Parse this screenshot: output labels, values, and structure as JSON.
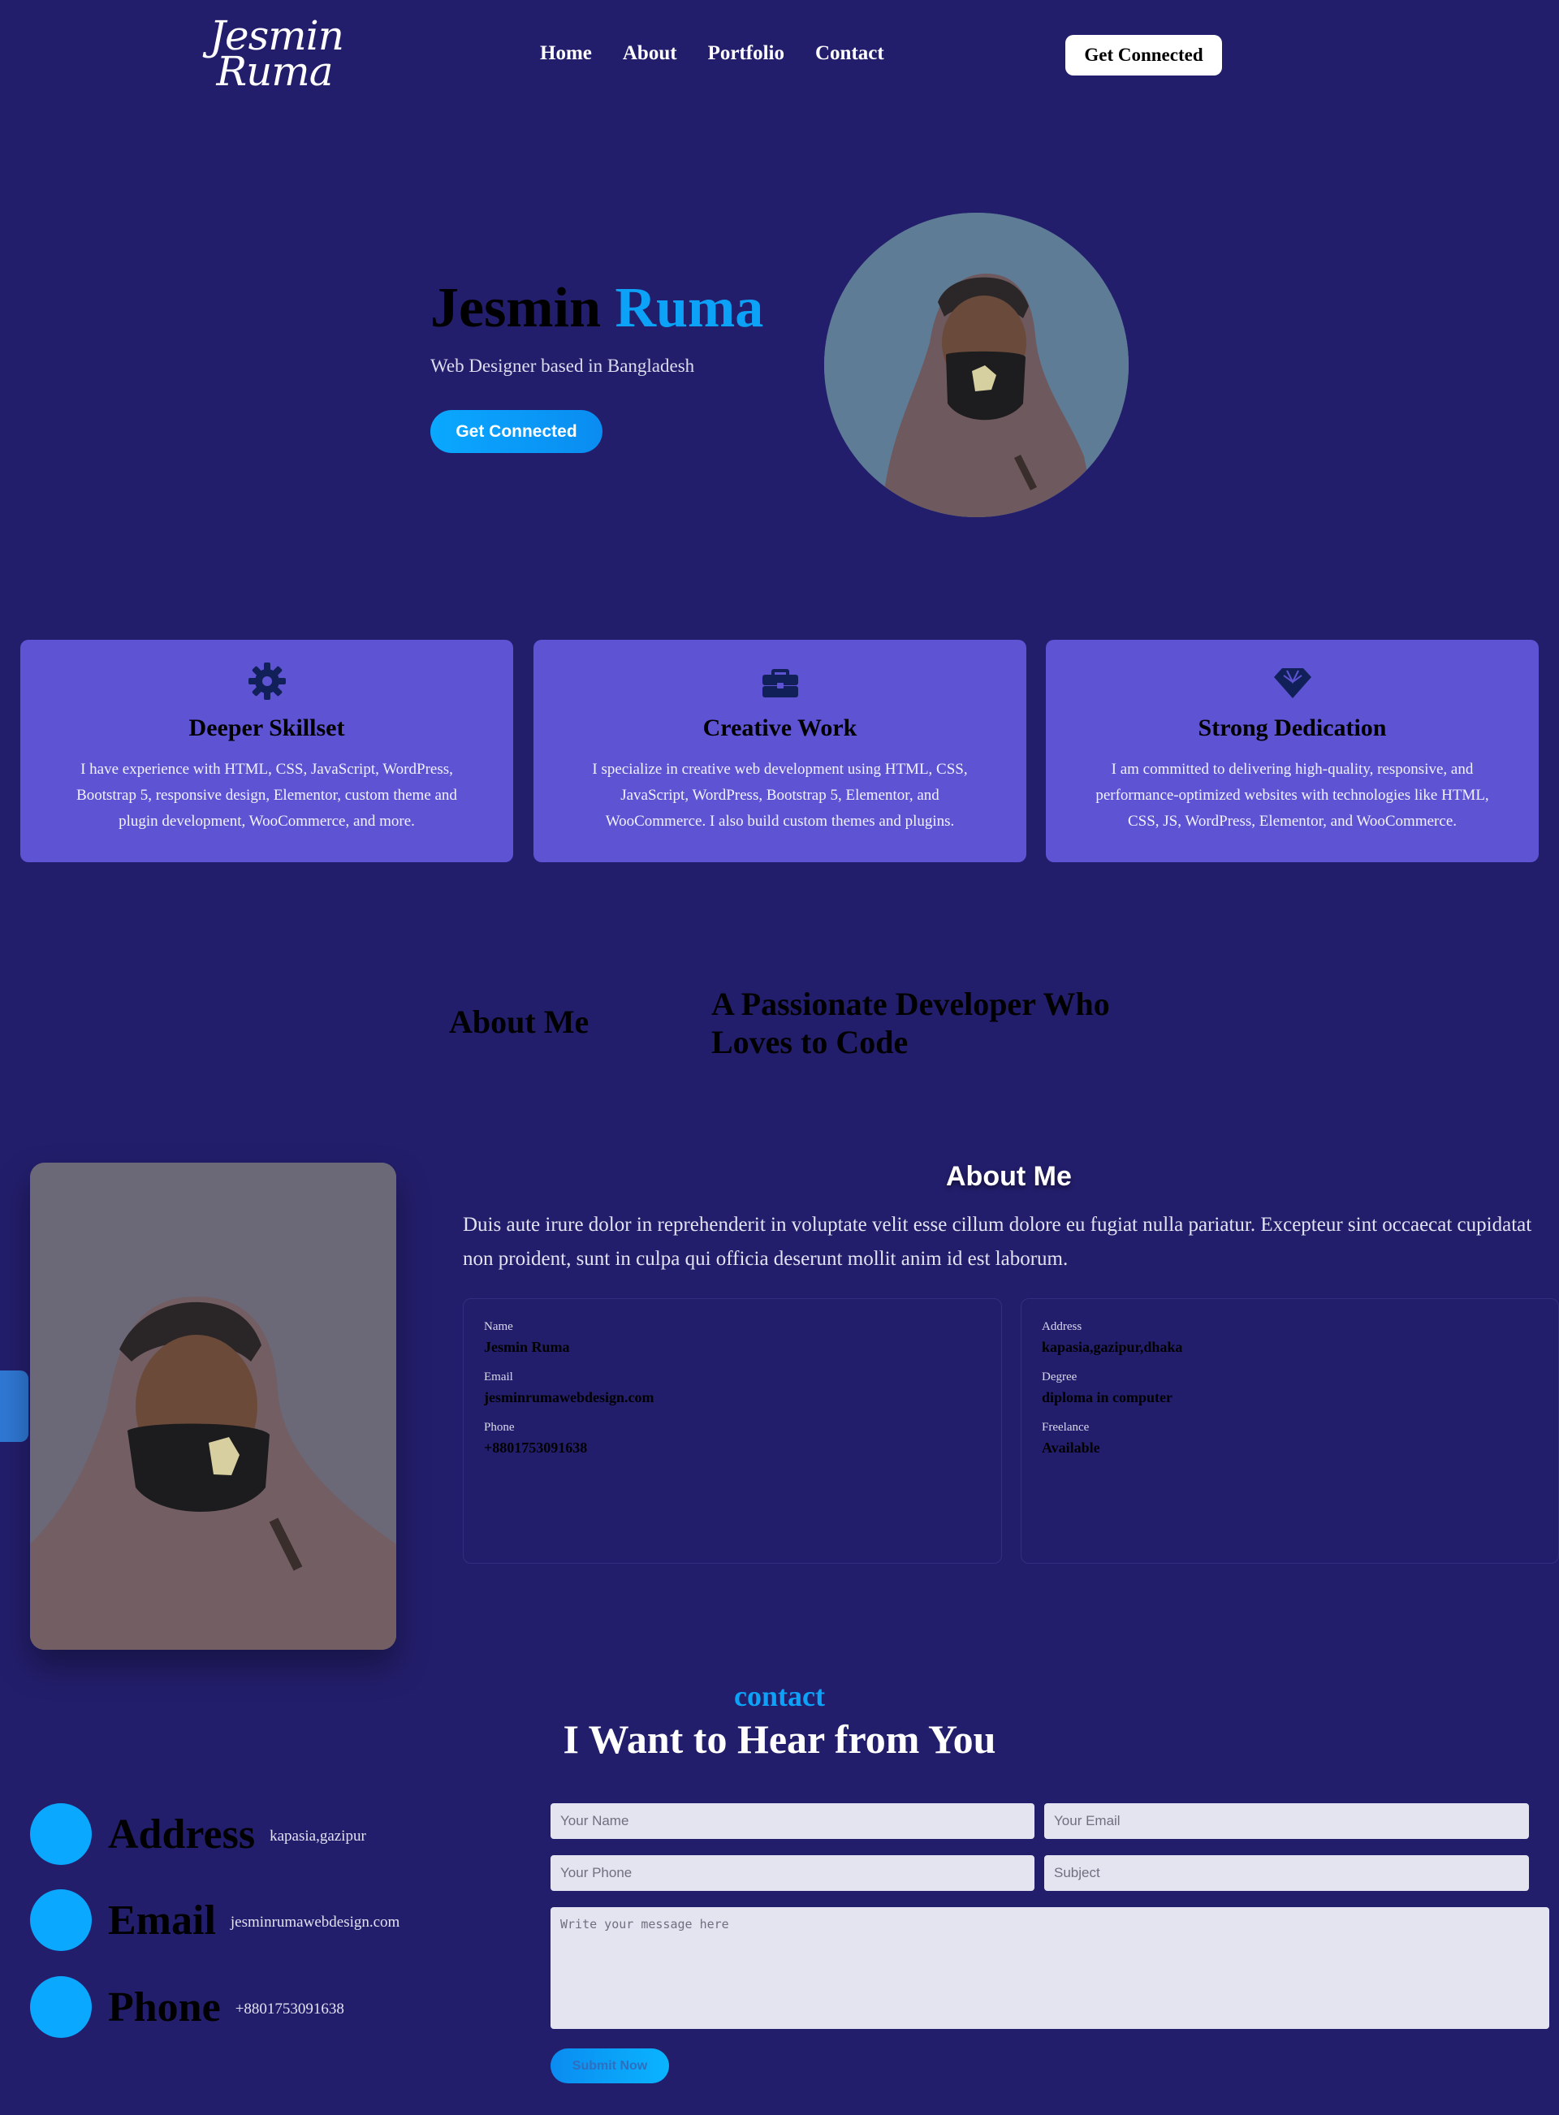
{
  "header": {
    "logo_line1": "Jesmin",
    "logo_line2": "Ruma",
    "nav": [
      "Home",
      "About",
      "Portfolio",
      "Contact"
    ],
    "cta": "Get Connected"
  },
  "hero": {
    "first_name": "Jesmin",
    "last_name": "Ruma",
    "subtitle": "Web Designer based in Bangladesh",
    "cta": "Get Connected"
  },
  "cards": [
    {
      "icon": "gear-icon",
      "title": "Deeper Skillset",
      "text": "I have experience with HTML, CSS, JavaScript, WordPress, Bootstrap 5, responsive design, Elementor, custom theme and plugin development, WooCommerce, and more."
    },
    {
      "icon": "briefcase-icon",
      "title": "Creative Work",
      "text": "I specialize in creative web development using HTML, CSS, JavaScript, WordPress, Bootstrap 5, Elementor, and WooCommerce. I also build custom themes and plugins."
    },
    {
      "icon": "diamond-icon",
      "title": "Strong Dedication",
      "text": "I am committed to delivering high-quality, responsive, and performance-optimized websites with technologies like HTML, CSS, JS, WordPress, Elementor, and WooCommerce."
    }
  ],
  "about_intro": {
    "heading": "About Me",
    "tagline": "A Passionate Developer Who Loves to Code"
  },
  "about": {
    "title": "About Me",
    "text": "Duis aute irure dolor in reprehenderit in voluptate velit esse cillum dolore eu fugiat nulla pariatur. Excepteur sint occaecat cupidatat non proident, sunt in culpa qui officia deserunt mollit anim id est laborum.",
    "left": [
      {
        "label": "Name",
        "value": "Jesmin Ruma"
      },
      {
        "label": "Email",
        "value": "jesminrumawebdesign.com"
      },
      {
        "label": "Phone",
        "value": "+8801753091638"
      }
    ],
    "right": [
      {
        "label": "Address",
        "value": "kapasia,gazipur,dhaka"
      },
      {
        "label": "Degree",
        "value": "diploma in computer"
      },
      {
        "label": "Freelance",
        "value": "Available"
      }
    ]
  },
  "contact": {
    "tag": "contact",
    "heading": "I Want to Hear from You",
    "items": [
      {
        "title": "Address",
        "value": "kapasia,gazipur"
      },
      {
        "title": "Email",
        "value": "jesminrumawebdesign.com"
      },
      {
        "title": "Phone",
        "value": "+8801753091638"
      }
    ],
    "form": {
      "name_placeholder": "Your Name",
      "email_placeholder": "Your Email",
      "phone_placeholder": "Your Phone",
      "subject_placeholder": "Subject",
      "message_placeholder": "Write your message here",
      "submit": "Submit Now"
    }
  },
  "colors": {
    "background": "#231e6b",
    "card": "#5d53d3",
    "accent": "#0ba2f7"
  }
}
